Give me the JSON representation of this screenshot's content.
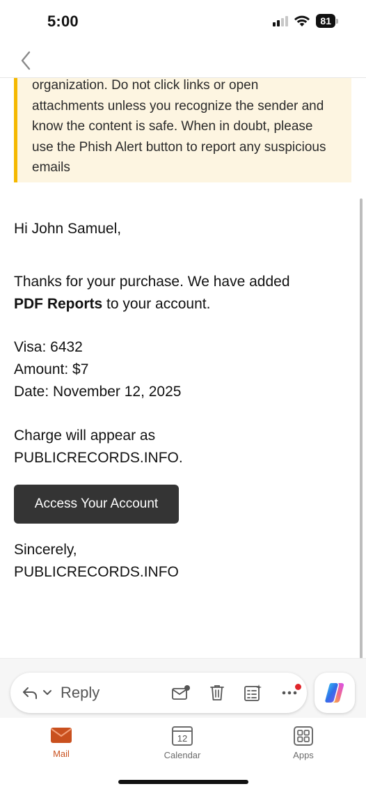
{
  "status_bar": {
    "time": "5:00",
    "battery": "81"
  },
  "nav": {
    "back_icon": "chevron-left-icon"
  },
  "banner": {
    "lines": [
      "organization. Do not click links or open",
      "attachments unless you recognize the sender and",
      "know the content is safe. When in doubt, please",
      "use the Phish Alert button to report any suspicious",
      "emails"
    ],
    "accent_color": "#f5b800",
    "background_color": "#fdf5e1"
  },
  "email": {
    "greeting": "Hi John Samuel,",
    "thanks_line1": "Thanks for your purchase. We have added",
    "product_name": "PDF Reports",
    "thanks_line2_rest": " to your account.",
    "visa": "Visa: 6432",
    "amount": "Amount: $7",
    "date": "Date: November 12, 2025",
    "charge_line1": "Charge will appear as",
    "charge_line2": "PUBLICRECORDS.INFO.",
    "cta_label": "Access Your Account",
    "signoff": "Sincerely,",
    "sender": "PUBLICRECORDS.INFO"
  },
  "actions": {
    "reply_label": "Reply",
    "icons": [
      "reply-icon",
      "chevron-down-icon",
      "mark-unread-icon",
      "trash-icon",
      "tasks-icon",
      "more-icon",
      "copilot-icon"
    ]
  },
  "tabs": [
    {
      "label": "Mail",
      "icon": "mail-icon",
      "active": true
    },
    {
      "label": "Calendar",
      "icon": "calendar-icon",
      "day": "12",
      "active": false
    },
    {
      "label": "Apps",
      "icon": "apps-icon",
      "active": false
    }
  ],
  "colors": {
    "accent": "#c9501e",
    "button_dark": "#343434"
  }
}
